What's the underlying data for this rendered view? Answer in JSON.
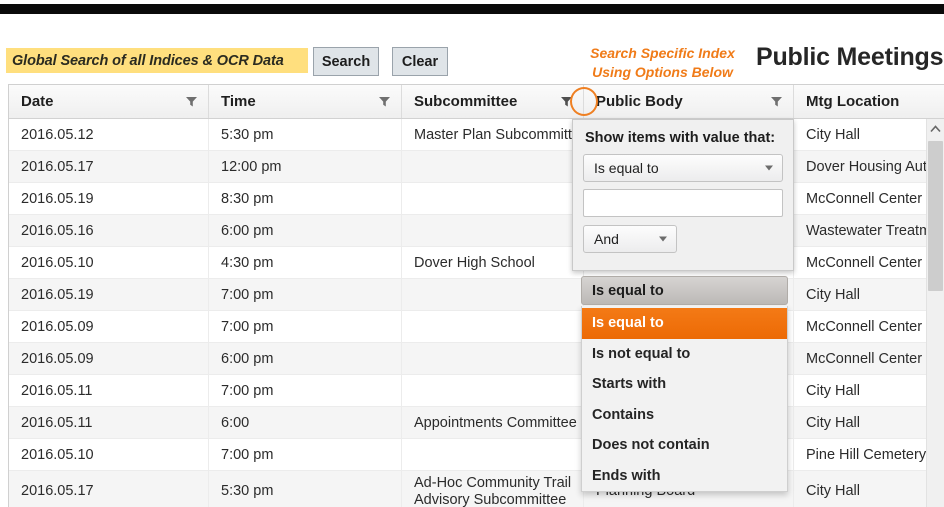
{
  "header": {
    "global_search_label": "Global Search of all Indices & OCR Data",
    "search_button": "Search",
    "clear_button": "Clear",
    "orange_note_line1": "Search Specific Index",
    "orange_note_line2": "Using Options Below",
    "page_title": "Public Meetings",
    "accent_color": "#f07b18",
    "highlight_color": "#ffdf7e"
  },
  "grid": {
    "columns": [
      {
        "label": "Date",
        "filter_icon": "filter-funnel-icon"
      },
      {
        "label": "Time",
        "filter_icon": "filter-funnel-icon"
      },
      {
        "label": "Subcommittee",
        "filter_icon": "filter-funnel-icon"
      },
      {
        "label": "Public Body",
        "filter_icon": "filter-funnel-icon"
      },
      {
        "label": "Mtg Location",
        "filter_icon": "filter-funnel-icon"
      }
    ],
    "rows": [
      {
        "date": "2016.05.12",
        "time": "5:30 pm",
        "subcommittee": "Master Plan Subcommittee",
        "public_body": "",
        "location": "City Hall"
      },
      {
        "date": "2016.05.17",
        "time": "12:00 pm",
        "subcommittee": "",
        "public_body": "",
        "location": "Dover Housing Author"
      },
      {
        "date": "2016.05.19",
        "time": "8:30 pm",
        "subcommittee": "",
        "public_body": "",
        "location": "McConnell Center"
      },
      {
        "date": "2016.05.16",
        "time": "6:00 pm",
        "subcommittee": "",
        "public_body": "",
        "location": "Wastewater Treatmen"
      },
      {
        "date": "2016.05.10",
        "time": "4:30 pm",
        "subcommittee": "Dover High School",
        "public_body": "",
        "location": "McConnell Center"
      },
      {
        "date": "2016.05.19",
        "time": "7:00 pm",
        "subcommittee": "",
        "public_body": "",
        "location": "City Hall"
      },
      {
        "date": "2016.05.09",
        "time": "7:00 pm",
        "subcommittee": "",
        "public_body": "",
        "location": "McConnell Center"
      },
      {
        "date": "2016.05.09",
        "time": "6:00 pm",
        "subcommittee": "",
        "public_body": "",
        "location": "McConnell Center"
      },
      {
        "date": "2016.05.11",
        "time": "7:00 pm",
        "subcommittee": "",
        "public_body": "",
        "location": "City Hall"
      },
      {
        "date": "2016.05.11",
        "time": "6:00",
        "subcommittee": "Appointments Committee",
        "public_body": "",
        "location": "City Hall"
      },
      {
        "date": "2016.05.10",
        "time": "7:00 pm",
        "subcommittee": "",
        "public_body": "",
        "location": "Pine Hill Cemetery"
      },
      {
        "date": "2016.05.17",
        "time": "5:30 pm",
        "subcommittee": "Ad-Hoc Community Trail Advisory Subcommittee",
        "public_body": "Planning Board",
        "location": "City Hall"
      }
    ]
  },
  "filter_panel": {
    "title": "Show items with value that:",
    "operator_1": "Is equal to",
    "value_1": "",
    "value_1_placeholder": "",
    "logic_operator": "And",
    "operator_2": "Is equal to",
    "options": [
      "Is equal to",
      "Is not equal to",
      "Starts with",
      "Contains",
      "Does not contain",
      "Ends with"
    ],
    "selected_option": "Is equal to",
    "selected_color": "#ef7012"
  },
  "scrollbar": {
    "up_arrow_icon": "chevron-up-icon"
  }
}
